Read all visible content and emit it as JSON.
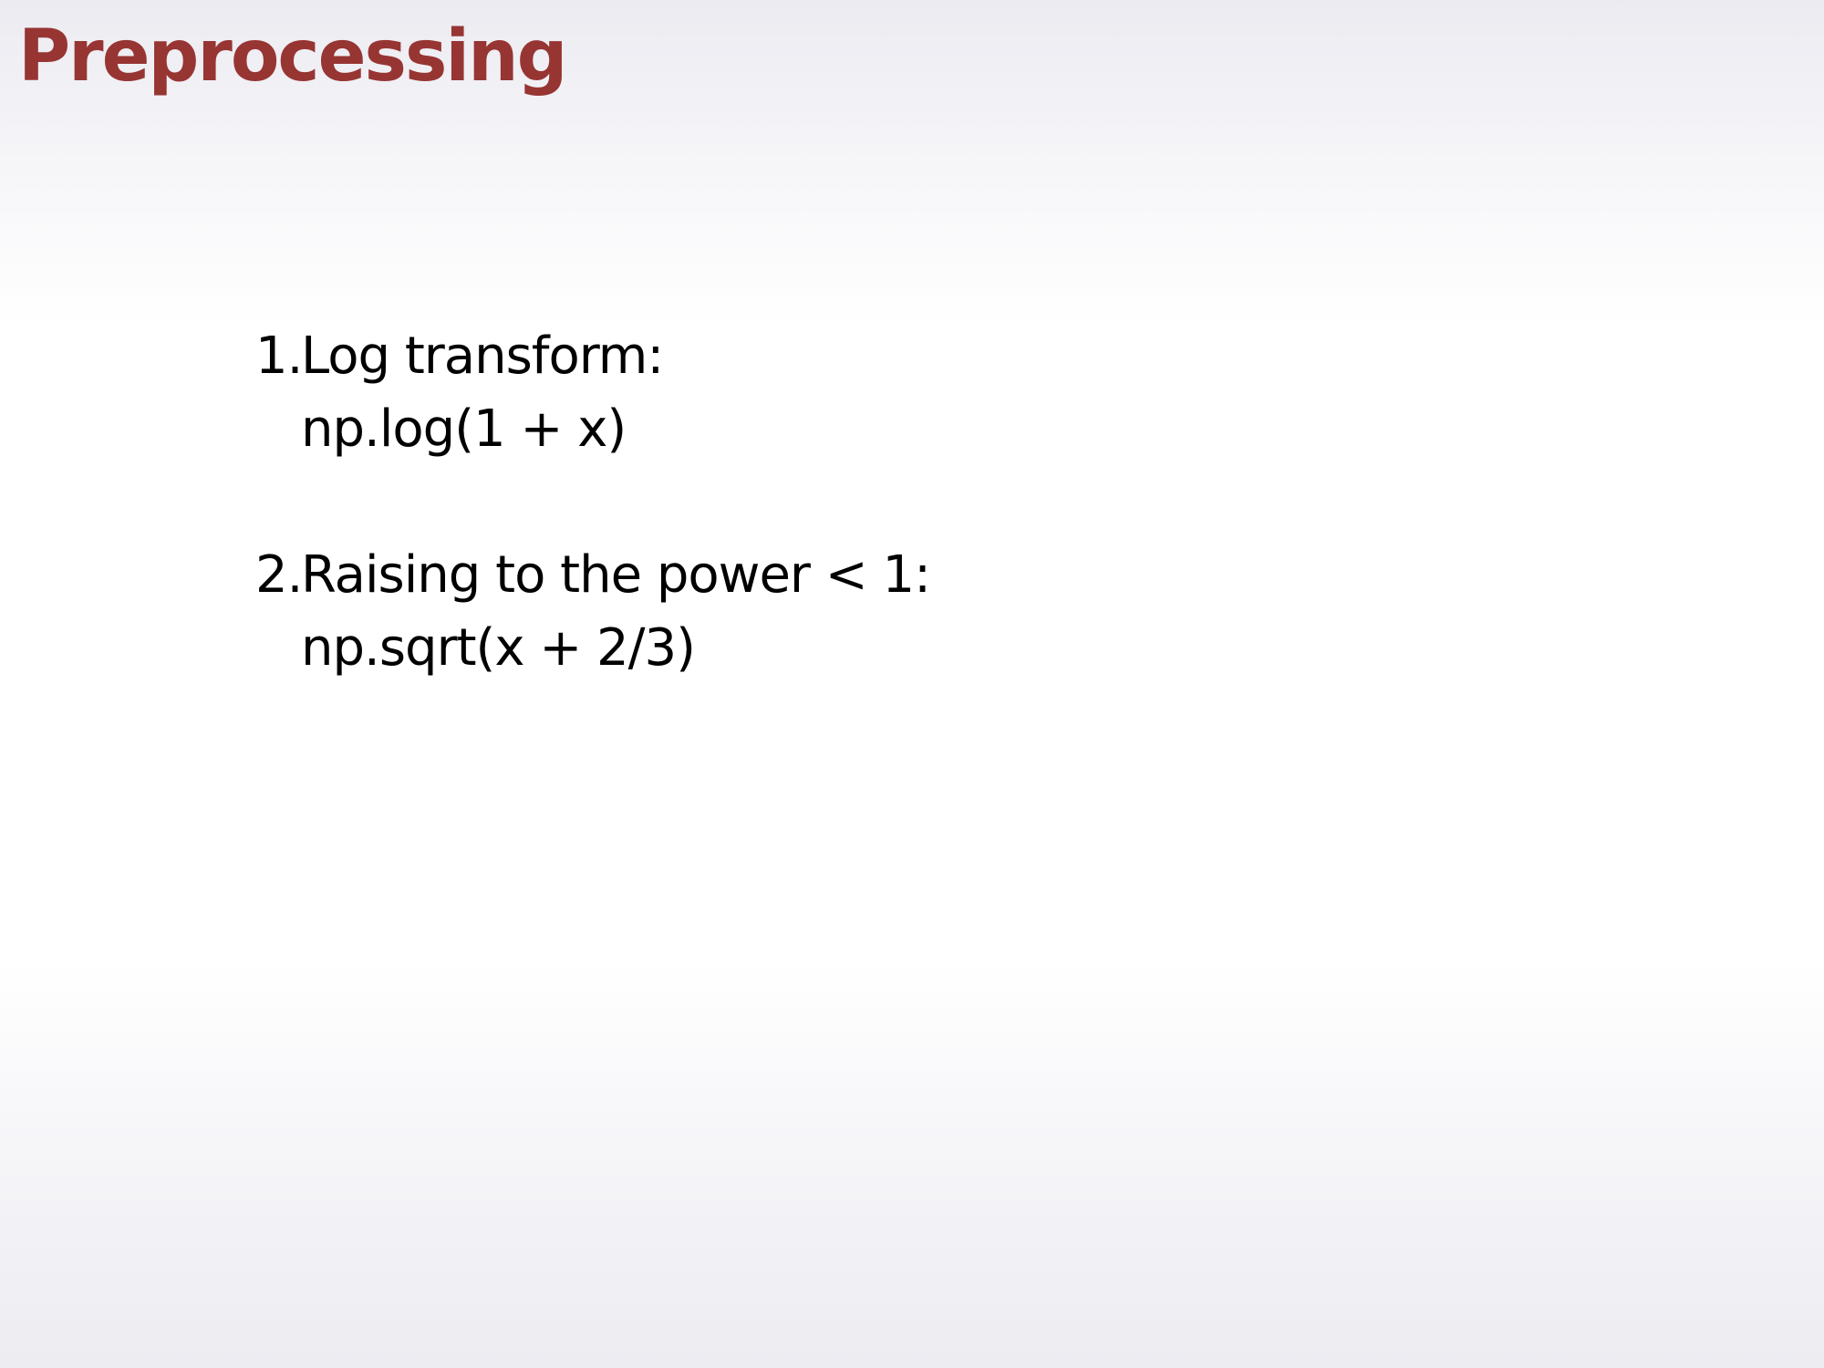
{
  "slide": {
    "title": "Preprocessing",
    "title_color": "#973533",
    "text_color": "#000000",
    "items": [
      {
        "number": "1.",
        "label": "Log transform:",
        "code": "np.log(1 + x)"
      },
      {
        "number": "2.",
        "label": "Raising to the power < 1:",
        "code": "np.sqrt(x + 2/3)"
      }
    ]
  }
}
